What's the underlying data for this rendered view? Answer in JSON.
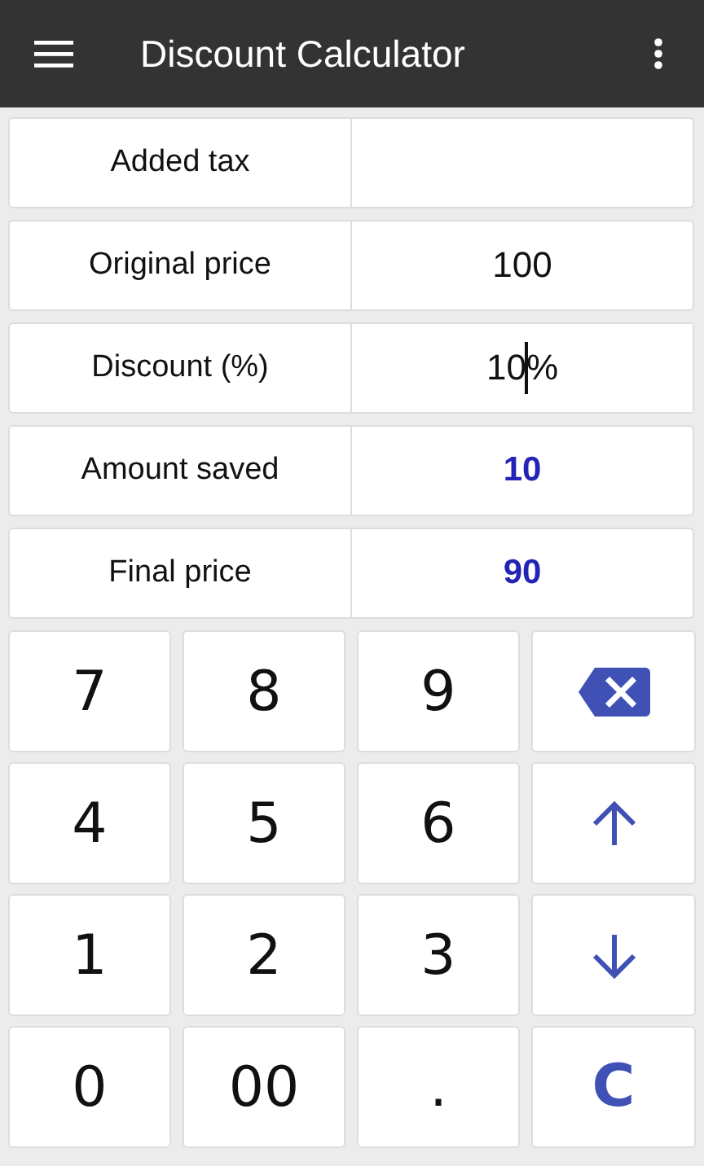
{
  "app_bar": {
    "title": "Discount Calculator"
  },
  "fields": [
    {
      "label": "Added tax",
      "kind": "input",
      "focused": false
    },
    {
      "label": "Original price",
      "kind": "input",
      "value": "100",
      "focused": false
    },
    {
      "label": "Discount (%)",
      "kind": "input",
      "value": "10%",
      "focused": true
    },
    {
      "label": "Amount saved",
      "kind": "result",
      "value": "10",
      "focused": false
    },
    {
      "label": "Final price",
      "kind": "result",
      "value": "90",
      "focused": false
    }
  ],
  "keys": [
    {
      "kind": "digit",
      "label": "7"
    },
    {
      "kind": "digit",
      "label": "8"
    },
    {
      "kind": "digit",
      "label": "9"
    },
    {
      "kind": "backspace"
    },
    {
      "kind": "digit",
      "label": "4"
    },
    {
      "kind": "digit",
      "label": "5"
    },
    {
      "kind": "digit",
      "label": "6"
    },
    {
      "kind": "up"
    },
    {
      "kind": "digit",
      "label": "1"
    },
    {
      "kind": "digit",
      "label": "2"
    },
    {
      "kind": "digit",
      "label": "3"
    },
    {
      "kind": "down"
    },
    {
      "kind": "digit",
      "label": "0"
    },
    {
      "kind": "digit",
      "label": "00"
    },
    {
      "kind": "digit",
      "label": "."
    },
    {
      "kind": "clear",
      "label": "C"
    }
  ]
}
